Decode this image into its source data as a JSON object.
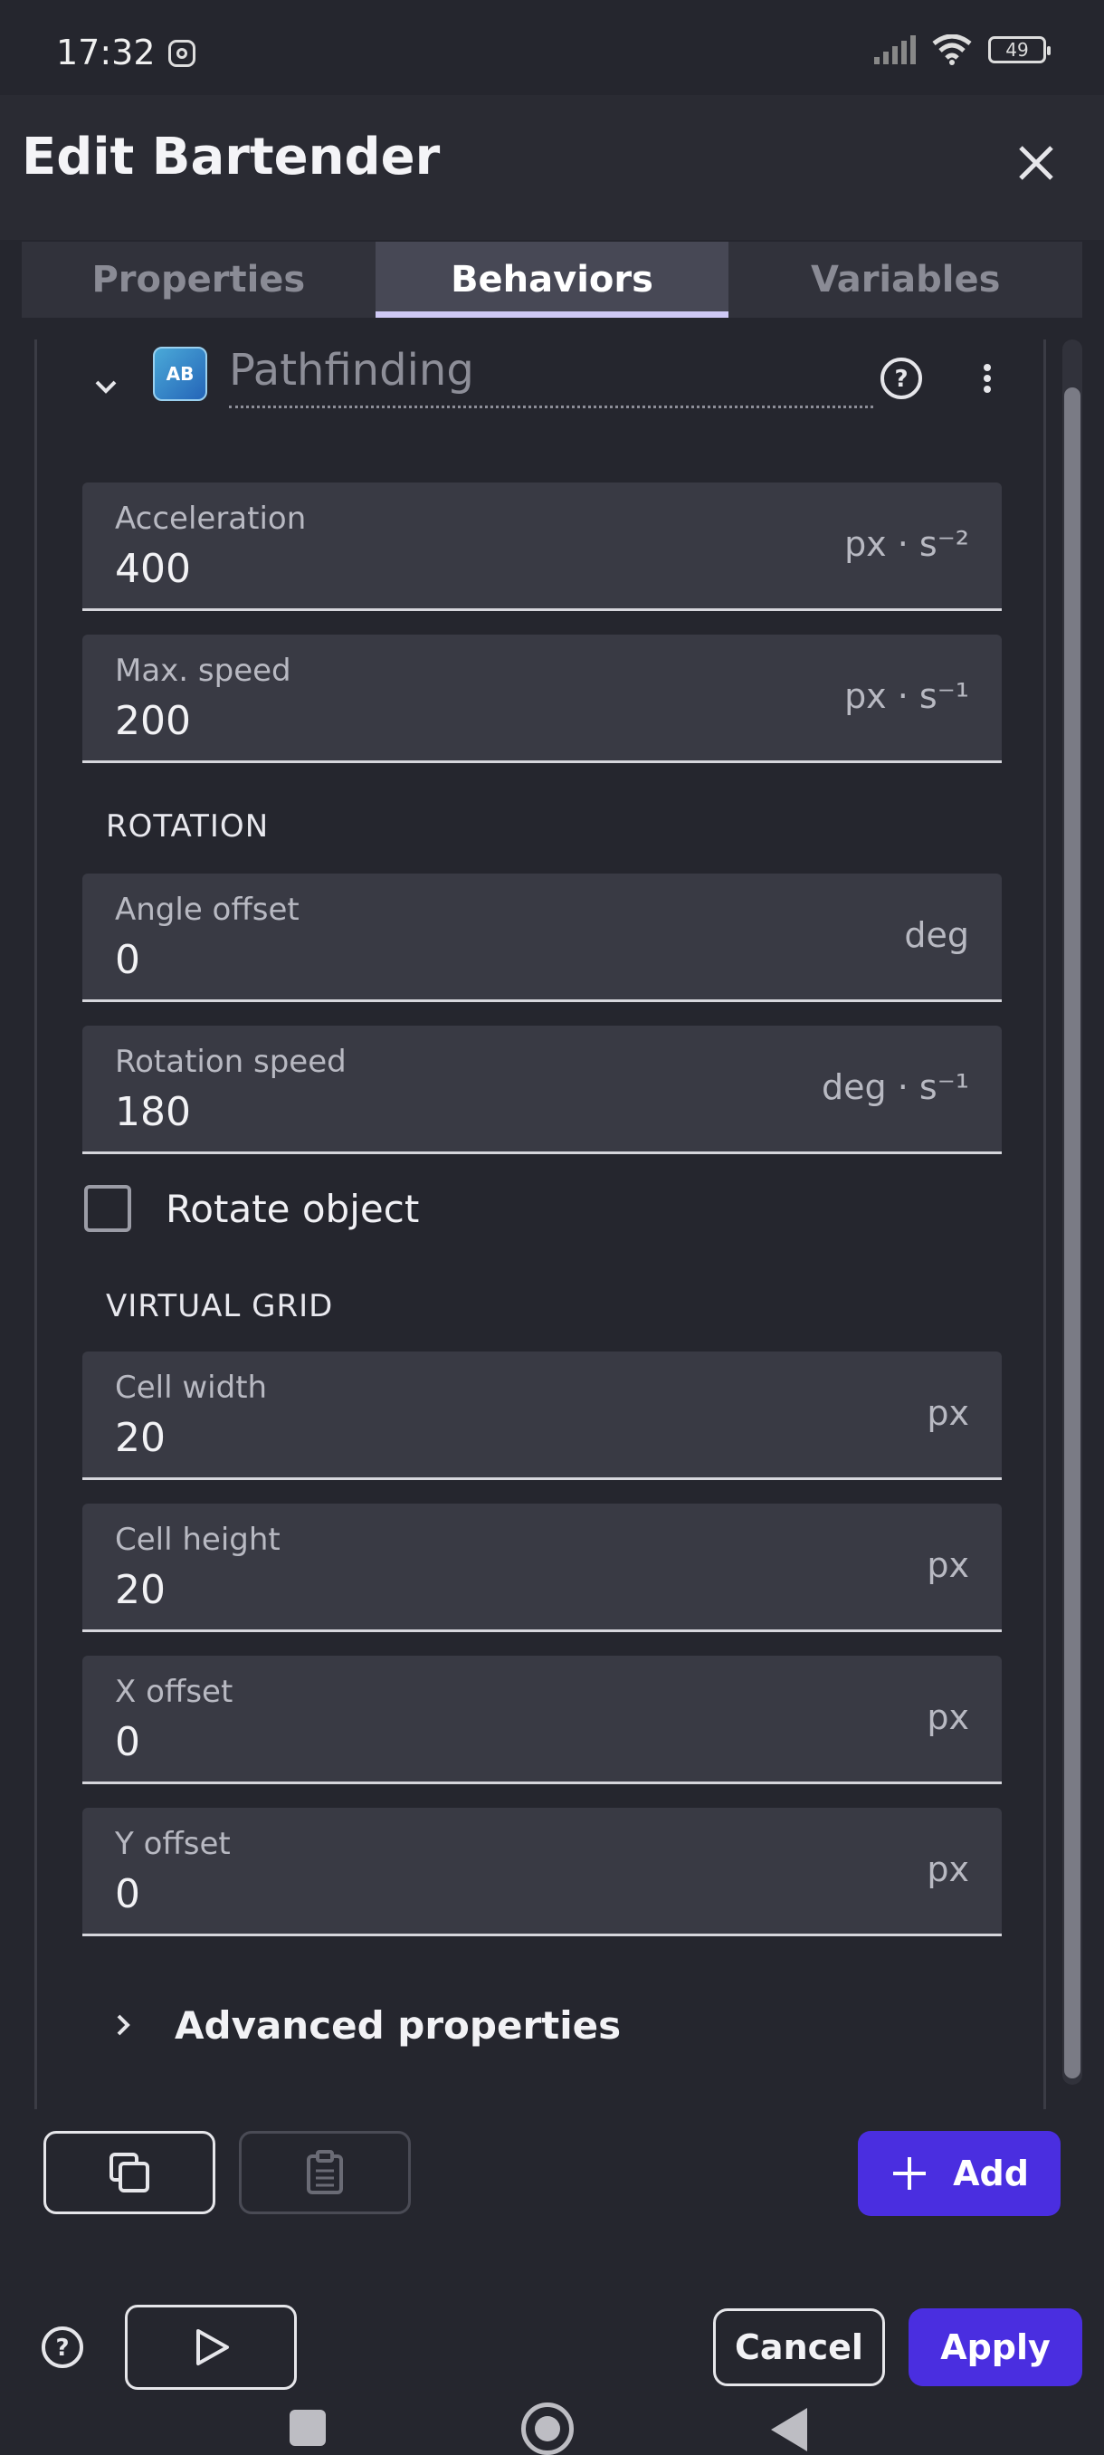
{
  "status": {
    "time": "17:32",
    "battery": "49"
  },
  "header": {
    "title": "Edit Bartender"
  },
  "tabs": [
    {
      "label": "Properties"
    },
    {
      "label": "Behaviors",
      "active": true
    },
    {
      "label": "Variables"
    }
  ],
  "behavior": {
    "name": "Pathfinding",
    "icon_text": "AB"
  },
  "fields": {
    "acceleration": {
      "label": "Acceleration",
      "value": "400",
      "unit": "px · s⁻²"
    },
    "max_speed": {
      "label": "Max. speed",
      "value": "200",
      "unit": "px · s⁻¹"
    },
    "angle_offset": {
      "label": "Angle offset",
      "value": "0",
      "unit": "deg"
    },
    "rotation_speed": {
      "label": "Rotation speed",
      "value": "180",
      "unit": "deg · s⁻¹"
    },
    "cell_width": {
      "label": "Cell width",
      "value": "20",
      "unit": "px"
    },
    "cell_height": {
      "label": "Cell height",
      "value": "20",
      "unit": "px"
    },
    "x_offset": {
      "label": "X offset",
      "value": "0",
      "unit": "px"
    },
    "y_offset": {
      "label": "Y offset",
      "value": "0",
      "unit": "px"
    }
  },
  "sections": {
    "rotation": "ROTATION",
    "virtual_grid": "VIRTUAL GRID"
  },
  "checkbox": {
    "label": "Rotate object",
    "checked": false
  },
  "advanced": {
    "label": "Advanced properties"
  },
  "actions": {
    "add_label": "Add"
  },
  "footer": {
    "cancel_label": "Cancel",
    "apply_label": "Apply"
  },
  "colors": {
    "accent": "#4a2ee0",
    "background": "#25262e",
    "field": "#393a44"
  }
}
